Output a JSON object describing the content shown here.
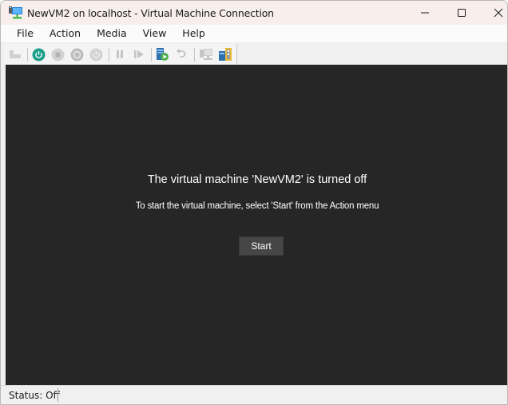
{
  "window": {
    "title": "NewVM2 on localhost - Virtual Machine Connection",
    "app_icon": "vm-connection-monitor-icon",
    "controls": {
      "minimize": "minimize-icon",
      "maximize": "maximize-icon",
      "close": "close-icon"
    }
  },
  "menubar": {
    "items": [
      {
        "label": "File"
      },
      {
        "label": "Action"
      },
      {
        "label": "Media"
      },
      {
        "label": "View"
      },
      {
        "label": "Help"
      }
    ]
  },
  "toolbar": {
    "buttons": [
      {
        "name": "ctrl-alt-del",
        "icon": "ctrl-alt-del-icon",
        "enabled": false
      },
      {
        "name": "start",
        "icon": "power-start-icon",
        "enabled": true,
        "color": "#1a9e8a"
      },
      {
        "name": "turn-off",
        "icon": "stop-icon",
        "enabled": false
      },
      {
        "name": "shut-down",
        "icon": "shutdown-icon",
        "enabled": false
      },
      {
        "name": "save",
        "icon": "save-state-icon",
        "enabled": false
      },
      {
        "name": "pause",
        "icon": "pause-icon",
        "enabled": false
      },
      {
        "name": "resume",
        "icon": "resume-icon",
        "enabled": false
      },
      {
        "name": "checkpoint",
        "icon": "checkpoint-icon",
        "enabled": true
      },
      {
        "name": "revert",
        "icon": "revert-icon",
        "enabled": false
      },
      {
        "name": "enhanced-session",
        "icon": "enhanced-session-icon",
        "enabled": false
      },
      {
        "name": "share",
        "icon": "share-usb-icon",
        "enabled": true
      }
    ]
  },
  "vm_display": {
    "heading": "The virtual machine 'NewVM2' is turned off",
    "instruction": "To start the virtual machine, select 'Start' from the Action menu",
    "start_button_label": "Start"
  },
  "statusbar": {
    "status_text": "Status: Off"
  }
}
